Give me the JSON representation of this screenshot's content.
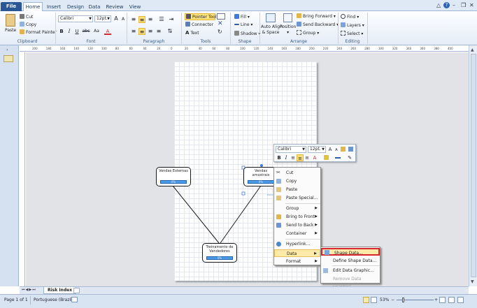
{
  "tabs": [
    "File",
    "Home",
    "Insert",
    "Design",
    "Data",
    "Review",
    "View"
  ],
  "window": {
    "minimize": "–",
    "restore": "❐",
    "close": "✕",
    "help": "?",
    "collapse": "△"
  },
  "ribbon": {
    "clipboard": {
      "paste": "Paste",
      "cut": "Cut",
      "copy": "Copy",
      "format_painter": "Format Painter",
      "label": "Clipboard"
    },
    "font": {
      "family": "Calibri",
      "size": "12pt.",
      "grow": "A",
      "shrink": "A",
      "bold": "B",
      "italic": "I",
      "underline": "U",
      "strike": "abc",
      "aa": "Aa",
      "color": "A",
      "label": "Font"
    },
    "paragraph": {
      "label": "Paragraph"
    },
    "tools": {
      "pointer": "Pointer Tool",
      "connector": "Connector",
      "text": "Text",
      "label": "Tools"
    },
    "shape": {
      "fill": "Fill",
      "line": "Line",
      "shadow": "Shadow",
      "label": "Shape"
    },
    "arrange": {
      "auto_align": "Auto Align",
      "and_space": "& Space",
      "position": "Position",
      "bring_forward": "Bring Forward",
      "send_backward": "Send Backward",
      "group": "Group",
      "label": "Arrange"
    },
    "editing": {
      "find": "Find",
      "layers": "Layers",
      "select": "Select",
      "label": "Editing"
    }
  },
  "ruler": {
    "h_ticks": [
      "200",
      "180",
      "160",
      "140",
      "120",
      "100",
      "80",
      "60",
      "40",
      "20",
      "0",
      "20",
      "40",
      "60",
      "80",
      "100",
      "120",
      "140",
      "160",
      "180",
      "200",
      "220",
      "240",
      "260",
      "280",
      "300",
      "320",
      "340",
      "360",
      "380",
      "400"
    ]
  },
  "shapes": {
    "vendas_externas": {
      "title": "Vendas Externas",
      "bar": "0%"
    },
    "vendas_amostrais": {
      "title1": "Vendas",
      "title2": "amostrais",
      "bar": "0%"
    },
    "treinamento": {
      "title1": "Treinamento de",
      "title2": "Vendedores",
      "bar": "0%"
    }
  },
  "mini_toolbar": {
    "font": "Calibri",
    "size": "12pt.",
    "bold": "B",
    "italic": "I",
    "color_a": "A"
  },
  "context_menu": {
    "cut": "Cut",
    "copy": "Copy",
    "paste": "Paste",
    "paste_special": "Paste Special...",
    "group": "Group",
    "bring_to_front": "Bring to Front",
    "send_to_back": "Send to Back",
    "container": "Container",
    "hyperlink": "Hyperlink...",
    "data": "Data",
    "format": "Format"
  },
  "submenu": {
    "shape_data": "Shape Data...",
    "define_shape_data": "Define Shape Data...",
    "edit_data_graphic": "Edit Data Graphic...",
    "remove_data_graphics": "Remove Data Graphics"
  },
  "page_tab": "Risk Index",
  "status": {
    "page": "Page 1 of 1",
    "language": "Portuguese (Brazil)",
    "zoom": "53%"
  },
  "colors": {
    "file_tab": "#2b5797",
    "highlight": "#fde9a8",
    "red_box": "#d9262c",
    "shape_bar": "#4a9be8"
  }
}
